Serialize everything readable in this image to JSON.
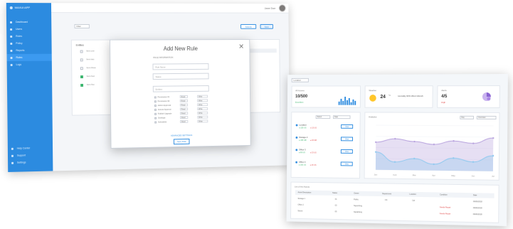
{
  "window1": {
    "brand": "MAXUI APP",
    "user_name": "Jane Doe",
    "sidebar": {
      "items": [
        {
          "label": "Dashboard",
          "icon": "grid-icon"
        },
        {
          "label": "Users",
          "icon": "user-icon"
        },
        {
          "label": "Roles",
          "icon": "shield-icon"
        },
        {
          "label": "Policy",
          "icon": "file-icon"
        },
        {
          "label": "Reports",
          "icon": "chart-icon"
        },
        {
          "label": "Rules",
          "icon": "list-icon",
          "active": true
        },
        {
          "label": "Logs",
          "icon": "clock-icon"
        }
      ],
      "bottom_items": [
        {
          "label": "Help Center",
          "icon": "help-icon"
        },
        {
          "label": "Support",
          "icon": "chat-icon"
        },
        {
          "label": "Settings",
          "icon": "gear-icon"
        }
      ]
    },
    "filter_select": "Filter",
    "actions": {
      "secondary": "Actions",
      "primary": "Save"
    },
    "card": {
      "title": "Entities",
      "rows": [
        {
          "label": "Item one",
          "checked": false
        },
        {
          "label": "Item two",
          "checked": false
        },
        {
          "label": "Item three",
          "checked": false
        },
        {
          "label": "Item four",
          "checked": true
        },
        {
          "label": "Item five",
          "checked": true
        }
      ]
    },
    "modal": {
      "title": "Add New Rule",
      "close": "✕",
      "section_label": "RULE INFORMATION",
      "fields": [
        {
          "placeholder": "Rule Name"
        },
        {
          "placeholder": "Status"
        },
        {
          "placeholder": "Entities"
        }
      ],
      "permissions": [
        {
          "name": "Permission 01",
          "a": "Read",
          "b": "Write"
        },
        {
          "name": "Permission 02",
          "a": "Read",
          "b": "Write"
        },
        {
          "name": "Admin Approval",
          "a": "Read",
          "b": "Write"
        },
        {
          "name": "Access Approve",
          "a": "Read",
          "b": "Write"
        },
        {
          "name": "Publish Upgrade",
          "a": "Read",
          "b": "Write"
        },
        {
          "name": "Overlaps",
          "a": "Read",
          "b": "Write"
        },
        {
          "name": "Schedules",
          "a": "Read",
          "b": "Write"
        }
      ],
      "link": "ADVANCED SETTINGS",
      "save": "Save Rule"
    }
  },
  "window2": {
    "dropdown": "Location",
    "card_all_access": {
      "label": "All Access",
      "value": "10/500",
      "sub": "Excellent"
    },
    "card_weather": {
      "label": "Weather",
      "value": "24",
      "unit": "°C",
      "desc": "Humidity 60% Wind 13km/h"
    },
    "card_alerts": {
      "label": "Alerts",
      "value": "4/5",
      "sub": "High"
    },
    "panel_filters": {
      "select_a": "Select",
      "select_b": "Date"
    },
    "locations": [
      {
        "name": "Location",
        "g": "● 150 US",
        "r": "● 15 US",
        "btn": "View"
      },
      {
        "name": "Storage 2",
        "g": "● 180 GB",
        "r": "● 40 GB",
        "btn": "View"
      },
      {
        "name": "Office 3",
        "g": "● 80 US",
        "r": "● 23 US",
        "btn": "View"
      },
      {
        "name": "Office 4",
        "g": "● 150 US",
        "r": "● 25 US",
        "btn": "View"
      }
    ],
    "chart_panel": {
      "label": "Analytics",
      "select_a": "Day",
      "select_b": "Overview"
    },
    "chart_data": {
      "type": "area",
      "x": [
        "Jan",
        "Feb",
        "Mar",
        "Apr",
        "May",
        "Jun",
        "Jul"
      ],
      "series": [
        {
          "color": "#b8a3de",
          "values": [
            62,
            70,
            64,
            58,
            66,
            61,
            73
          ]
        },
        {
          "color": "#8fc9ef",
          "values": [
            40,
            18,
            26,
            14,
            28,
            20,
            34
          ]
        }
      ],
      "ylim": [
        0,
        100
      ],
      "grid": true
    },
    "table": {
      "title": "List of the Assets",
      "headers": [
        "Asset Description",
        "Status",
        "Owner",
        "Department",
        "Location",
        "Condition",
        "Date"
      ],
      "rows": [
        [
          "Storage 1",
          "01",
          "Public",
          "CS",
          "Cal",
          "",
          "06/06/2018"
        ],
        [
          "Office 2",
          "03",
          "Signal Eng",
          "",
          "",
          "Needs Repair",
          "06/06/2018"
        ],
        [
          "Server",
          "05",
          "Signal Eng",
          "",
          "",
          "Needs Repair",
          "06/06/2018"
        ]
      ]
    }
  }
}
